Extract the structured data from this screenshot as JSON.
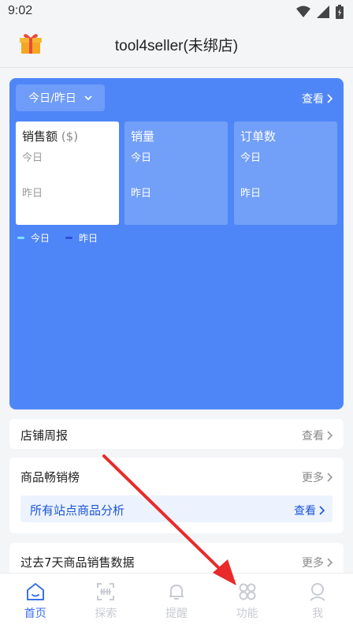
{
  "status": {
    "time": "9:02"
  },
  "header": {
    "title": "tool4seller(未绑店)"
  },
  "overview": {
    "date_range": "今日/昨日",
    "view_label": "查看",
    "metrics": [
      {
        "title": "销售额",
        "unit": "($)",
        "today": "今日",
        "yesterday": "昨日"
      },
      {
        "title": "销量",
        "today": "今日",
        "yesterday": "昨日"
      },
      {
        "title": "订单数",
        "today": "今日",
        "yesterday": "昨日"
      }
    ],
    "legend": [
      {
        "label": "今日",
        "color": "#7fe0ff"
      },
      {
        "label": "昨日",
        "color": "#2d4fd8"
      }
    ]
  },
  "weekly_report": {
    "title": "店铺周报",
    "action": "查看"
  },
  "bestsellers": {
    "title": "商品畅销榜",
    "action": "更多",
    "sub_title": "所有站点商品分析",
    "sub_action": "查看"
  },
  "past7days": {
    "title": "过去7天商品销售数据",
    "action": "更多"
  },
  "tabs": [
    {
      "label": "首页",
      "icon": "home-icon",
      "active": true
    },
    {
      "label": "探索",
      "icon": "scan-icon",
      "active": false
    },
    {
      "label": "提醒",
      "icon": "bell-icon",
      "active": false
    },
    {
      "label": "功能",
      "icon": "grid-icon",
      "active": false
    },
    {
      "label": "我",
      "icon": "user-icon",
      "active": false
    }
  ],
  "colors": {
    "primary": "#4f86f7",
    "accent": "#3a6ff0",
    "arrow": "#e82a2a"
  }
}
